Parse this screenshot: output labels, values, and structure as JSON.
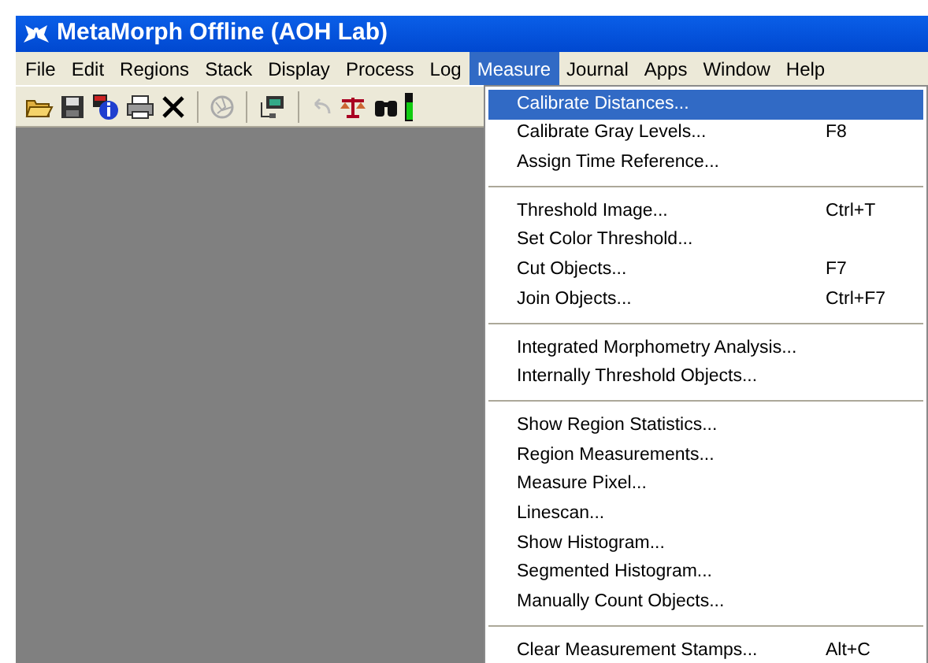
{
  "window": {
    "title": "MetaMorph Offline (AOH Lab)"
  },
  "menubar": [
    {
      "label": "File",
      "selected": false
    },
    {
      "label": "Edit",
      "selected": false
    },
    {
      "label": "Regions",
      "selected": false
    },
    {
      "label": "Stack",
      "selected": false
    },
    {
      "label": "Display",
      "selected": false
    },
    {
      "label": "Process",
      "selected": false
    },
    {
      "label": "Log",
      "selected": false
    },
    {
      "label": "Measure",
      "selected": true
    },
    {
      "label": "Journal",
      "selected": false
    },
    {
      "label": "Apps",
      "selected": false
    },
    {
      "label": "Window",
      "selected": false
    },
    {
      "label": "Help",
      "selected": false
    }
  ],
  "menu": {
    "groups": [
      [
        {
          "label": "Calibrate Distances...",
          "selected": true
        },
        {
          "label": "Calibrate Gray Levels...",
          "shortcut": "F8",
          "selected": false
        },
        {
          "label": "Assign Time Reference...",
          "selected": false
        }
      ],
      [
        {
          "label": "Threshold Image...",
          "shortcut": "Ctrl+T",
          "selected": false
        },
        {
          "label": "Set Color Threshold...",
          "selected": false
        },
        {
          "label": "Cut Objects...",
          "shortcut": "F7",
          "selected": false
        },
        {
          "label": "Join Objects...",
          "shortcut": "Ctrl+F7",
          "selected": false
        }
      ],
      [
        {
          "label": "Integrated Morphometry Analysis...",
          "selected": false
        },
        {
          "label": "Internally Threshold Objects...",
          "selected": false
        }
      ],
      [
        {
          "label": "Show Region Statistics...",
          "selected": false
        },
        {
          "label": "Region Measurements...",
          "selected": false
        },
        {
          "label": "Measure Pixel...",
          "selected": false
        },
        {
          "label": "Linescan...",
          "selected": false
        },
        {
          "label": "Show Histogram...",
          "selected": false
        },
        {
          "label": "Segmented Histogram...",
          "selected": false
        },
        {
          "label": "Manually Count Objects...",
          "selected": false
        }
      ],
      [
        {
          "label": "Clear Measurement Stamps...",
          "shortcut": "Alt+C",
          "selected": false
        }
      ]
    ]
  }
}
